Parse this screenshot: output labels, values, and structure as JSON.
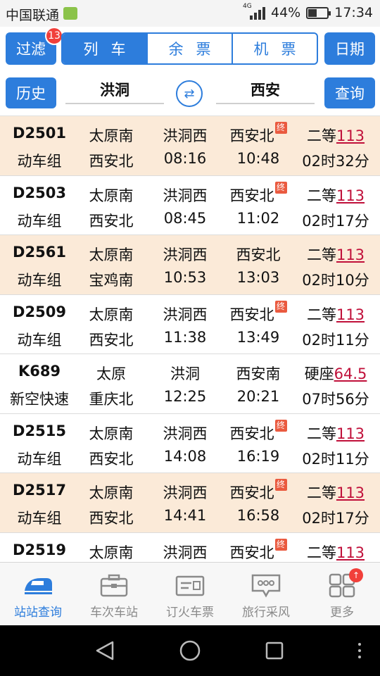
{
  "status_bar": {
    "carrier": "中国联通",
    "network": "4G",
    "battery_percent": "44%",
    "battery_level": 0.44,
    "time": "17:34"
  },
  "header": {
    "filter_label": "过滤",
    "filter_badge": "13",
    "tabs": [
      {
        "label": "列车",
        "active": true
      },
      {
        "label": "余票",
        "active": false
      },
      {
        "label": "机票",
        "active": false
      }
    ],
    "date_label": "日期",
    "history_label": "历史",
    "from_station": "洪洞",
    "to_station": "西安",
    "search_label": "查询"
  },
  "trains": [
    {
      "train_no": "D2501",
      "train_type": "动车组",
      "origin": "太原南",
      "dest": "西安北",
      "from": "洪洞西",
      "depart": "08:16",
      "to": "西安北",
      "arrive": "10:48",
      "terminal": true,
      "seat_class": "二等",
      "price": "113",
      "duration": "02时32分"
    },
    {
      "train_no": "D2503",
      "train_type": "动车组",
      "origin": "太原南",
      "dest": "西安北",
      "from": "洪洞西",
      "depart": "08:45",
      "to": "西安北",
      "arrive": "11:02",
      "terminal": true,
      "seat_class": "二等",
      "price": "113",
      "duration": "02时17分"
    },
    {
      "train_no": "D2561",
      "train_type": "动车组",
      "origin": "太原南",
      "dest": "宝鸡南",
      "from": "洪洞西",
      "depart": "10:53",
      "to": "西安北",
      "arrive": "13:03",
      "terminal": false,
      "seat_class": "二等",
      "price": "113",
      "duration": "02时10分"
    },
    {
      "train_no": "D2509",
      "train_type": "动车组",
      "origin": "太原南",
      "dest": "西安北",
      "from": "洪洞西",
      "depart": "11:38",
      "to": "西安北",
      "arrive": "13:49",
      "terminal": true,
      "seat_class": "二等",
      "price": "113",
      "duration": "02时11分"
    },
    {
      "train_no": "K689",
      "train_type": "新空快速",
      "origin": "太原",
      "dest": "重庆北",
      "from": "洪洞",
      "depart": "12:25",
      "to": "西安南",
      "arrive": "20:21",
      "terminal": false,
      "seat_class": "硬座",
      "price": "64.5",
      "duration": "07时56分"
    },
    {
      "train_no": "D2515",
      "train_type": "动车组",
      "origin": "太原南",
      "dest": "西安北",
      "from": "洪洞西",
      "depart": "14:08",
      "to": "西安北",
      "arrive": "16:19",
      "terminal": true,
      "seat_class": "二等",
      "price": "113",
      "duration": "02时11分"
    },
    {
      "train_no": "D2517",
      "train_type": "动车组",
      "origin": "太原南",
      "dest": "西安北",
      "from": "洪洞西",
      "depart": "14:41",
      "to": "西安北",
      "arrive": "16:58",
      "terminal": true,
      "seat_class": "二等",
      "price": "113",
      "duration": "02时17分"
    },
    {
      "train_no": "D2519",
      "train_type": "",
      "origin": "太原南",
      "dest": "",
      "from": "洪洞西",
      "depart": "",
      "to": "西安北",
      "arrive": "",
      "terminal": true,
      "seat_class": "二等",
      "price": "113",
      "duration": ""
    }
  ],
  "terminal_mark": "终",
  "bottom_tabs": [
    {
      "label": "站站查询",
      "icon": "train-icon",
      "active": true
    },
    {
      "label": "车次车站",
      "icon": "briefcase-icon",
      "active": false
    },
    {
      "label": "订火车票",
      "icon": "ticket-icon",
      "active": false
    },
    {
      "label": "旅行采风",
      "icon": "chat-bubble-icon",
      "active": false
    },
    {
      "label": "更多",
      "icon": "grid-icon",
      "active": false,
      "badge": "↑"
    }
  ],
  "colors": {
    "accent": "#2d7ddc",
    "row_highlight": "#fbead8",
    "price": "#c0103a",
    "terminal_badge": "#ea5a3f"
  }
}
